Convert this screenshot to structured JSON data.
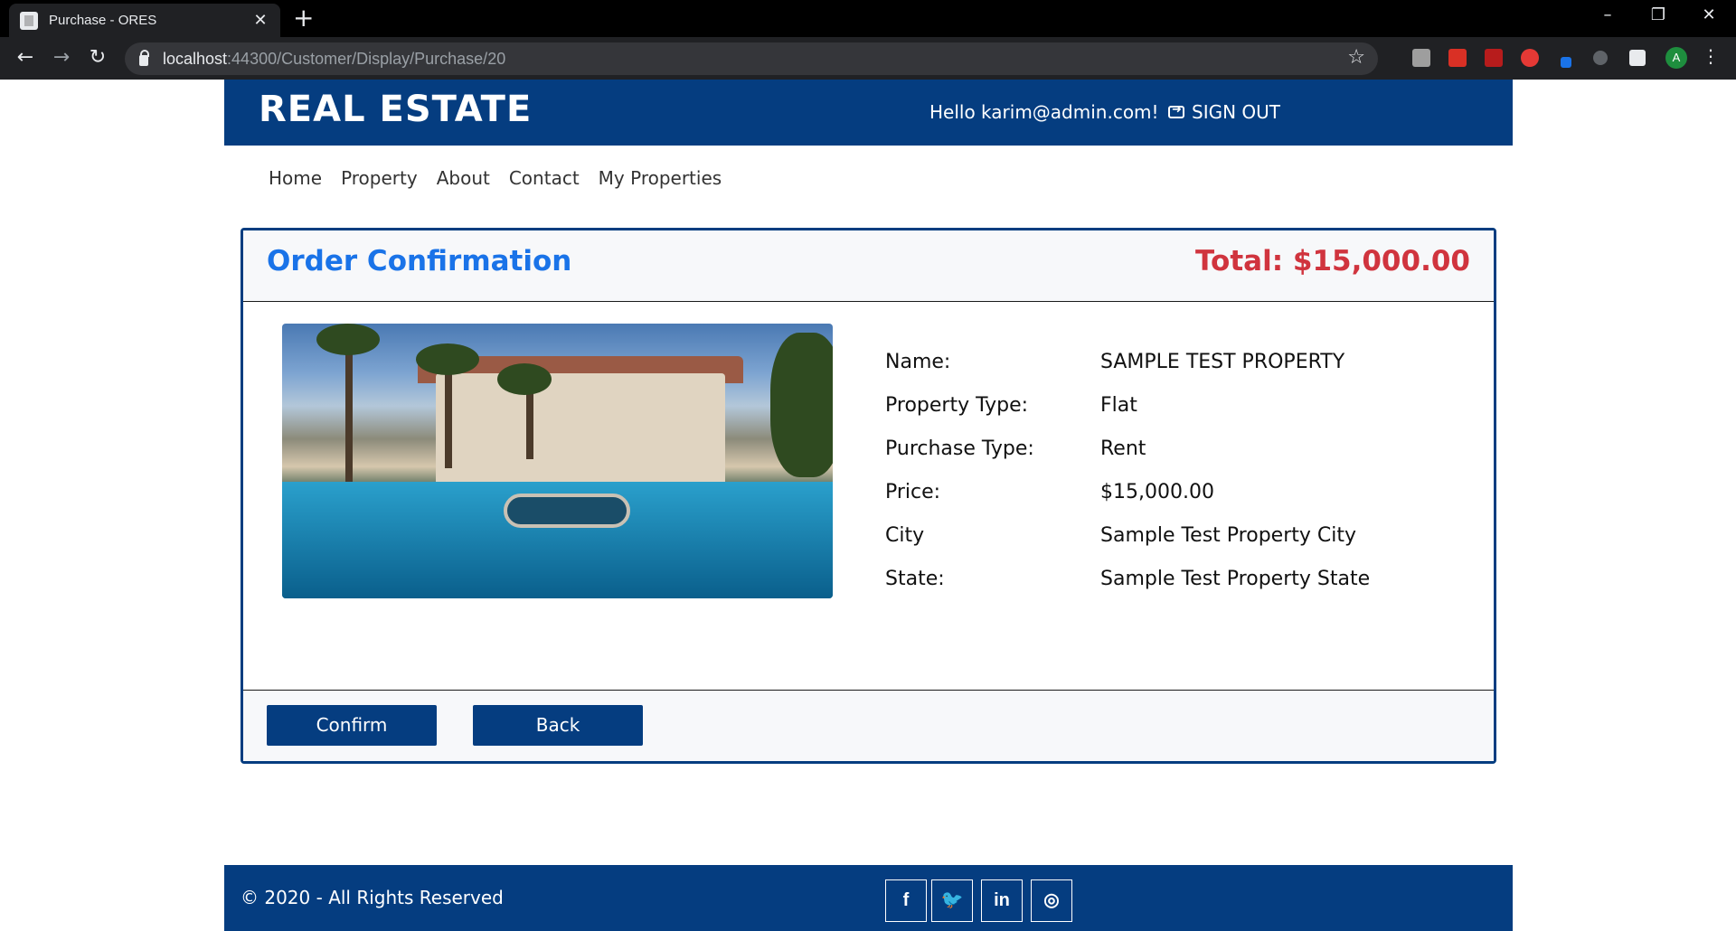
{
  "browser": {
    "tab_title": "Purchase - ORES",
    "url_host": "localhost",
    "url_path": ":44300/Customer/Display/Purchase/20",
    "avatar_letter": "A"
  },
  "header": {
    "brand": "REAL ESTATE",
    "greeting": "Hello karim@admin.com!",
    "signout": "SIGN OUT"
  },
  "nav": {
    "items": [
      "Home",
      "Property",
      "About",
      "Contact",
      "My Properties"
    ]
  },
  "order": {
    "title": "Order Confirmation",
    "total": "Total: $15,000.00",
    "details": [
      {
        "label": "Name:",
        "value": "SAMPLE TEST PROPERTY"
      },
      {
        "label": "Property Type:",
        "value": "Flat"
      },
      {
        "label": "Purchase Type:",
        "value": "Rent"
      },
      {
        "label": "Price:",
        "value": "$15,000.00"
      },
      {
        "label": "City",
        "value": "Sample Test Property City"
      },
      {
        "label": "State:",
        "value": "Sample Test Property State"
      }
    ],
    "confirm_label": "Confirm",
    "back_label": "Back"
  },
  "footer": {
    "copyright": "© 2020 - All Rights Reserved",
    "social": [
      "f",
      "t",
      "in",
      "ig"
    ]
  },
  "colors": {
    "brand_blue": "#053d80",
    "title_blue": "#1a73e8",
    "total_red": "#d0343e"
  }
}
